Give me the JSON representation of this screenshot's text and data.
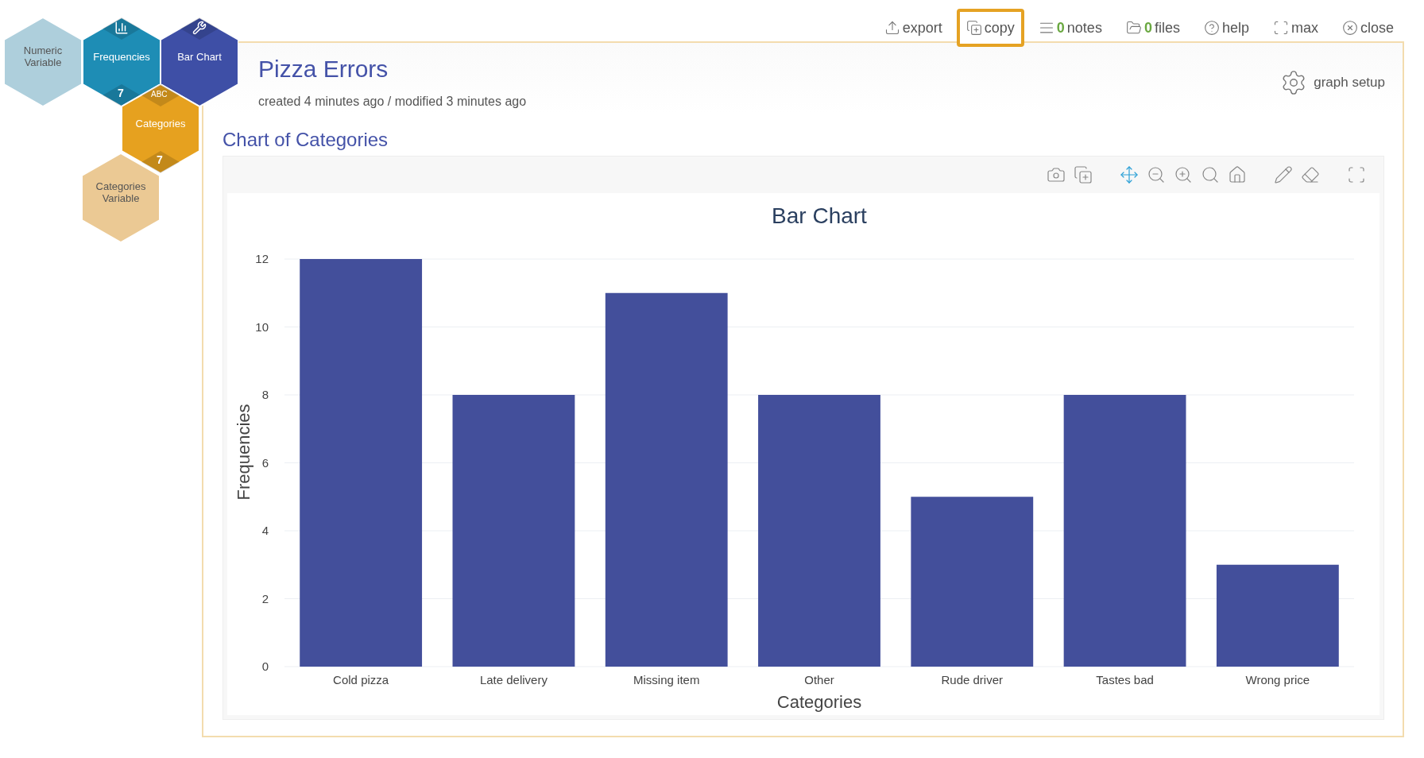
{
  "hexagons": [
    {
      "label": "Numeric Variable",
      "color": "#aecfdc",
      "kind": "plain"
    },
    {
      "label": "Frequencies",
      "color": "#1e8db5",
      "kind": "bars",
      "badge": "7"
    },
    {
      "label": "Bar Chart",
      "color": "#3e4fa6",
      "kind": "wrench"
    },
    {
      "label": "Categories",
      "color": "#e6a11f",
      "kind": "text",
      "top_text": "ABC",
      "badge": "7"
    },
    {
      "label": "Categories Variable",
      "color": "#ebc994",
      "kind": "plain"
    }
  ],
  "toolbar": [
    {
      "kind": "export",
      "label": "export",
      "highlighted": false
    },
    {
      "kind": "copy",
      "label": "copy",
      "highlighted": true
    },
    {
      "kind": "notes",
      "count": "0",
      "label": "notes",
      "highlighted": false
    },
    {
      "kind": "files",
      "count": "0",
      "label": "files",
      "highlighted": false
    },
    {
      "kind": "help",
      "label": "help",
      "highlighted": false
    },
    {
      "kind": "max",
      "label": "max",
      "highlighted": false
    },
    {
      "kind": "close",
      "label": "close",
      "highlighted": false
    }
  ],
  "title": "Pizza Errors",
  "subtitle": "created 4 minutes ago / modified 3 minutes ago",
  "graph_setup": "graph setup",
  "section_title": "Chart of Categories",
  "chart_data": {
    "type": "bar",
    "title": "Bar Chart",
    "xlabel": "Categories",
    "ylabel": "Frequencies",
    "categories": [
      "Cold pizza",
      "Late delivery",
      "Missing item",
      "Other",
      "Rude driver",
      "Tastes bad",
      "Wrong price"
    ],
    "values": [
      12,
      8,
      11,
      8,
      5,
      8,
      3
    ],
    "ylim": [
      0,
      12
    ],
    "grid": true,
    "yticks": [
      0,
      2,
      4,
      6,
      8,
      10,
      12
    ]
  }
}
